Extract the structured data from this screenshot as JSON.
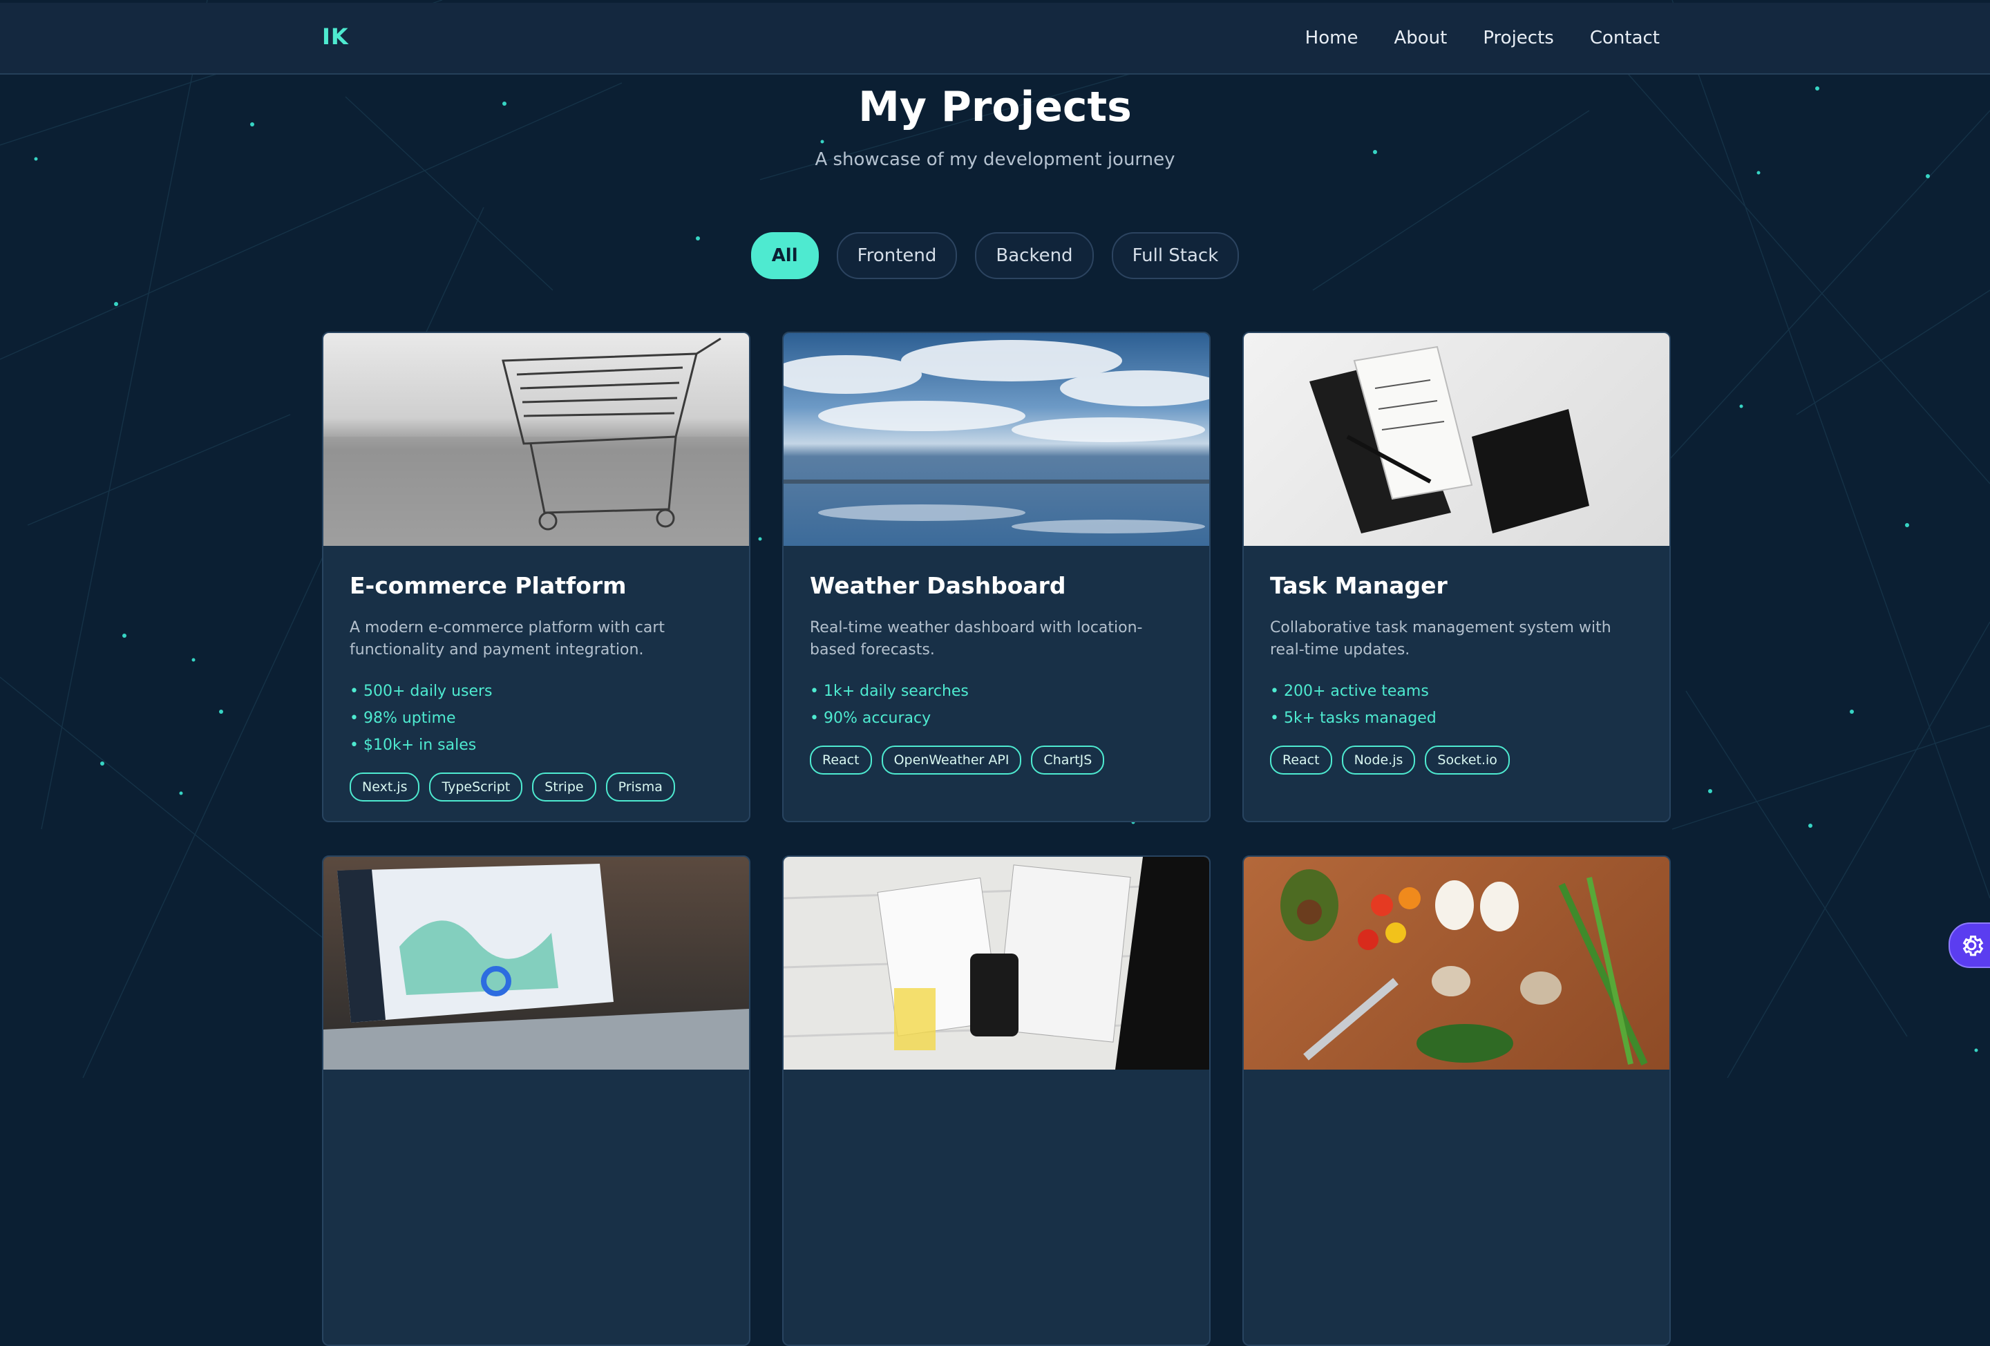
{
  "brand": {
    "logo": "IK"
  },
  "nav": {
    "items": [
      "Home",
      "About",
      "Projects",
      "Contact"
    ]
  },
  "hero": {
    "title": "My Projects",
    "subtitle": "A showcase of my development journey"
  },
  "filters": {
    "items": [
      "All",
      "Frontend",
      "Backend",
      "Full Stack"
    ],
    "active": "All"
  },
  "projects": [
    {
      "title": "E-commerce Platform",
      "description": "A modern e-commerce platform with cart functionality and payment integration.",
      "metrics": [
        "• 500+ daily users",
        "• 98% uptime",
        "• $10k+ in sales"
      ],
      "tags": [
        "Next.js",
        "TypeScript",
        "Stripe",
        "Prisma"
      ],
      "image": "shopping-cart-photo"
    },
    {
      "title": "Weather Dashboard",
      "description": "Real-time weather dashboard with location-based forecasts.",
      "metrics": [
        "• 1k+ daily searches",
        "• 90% accuracy"
      ],
      "tags": [
        "React",
        "OpenWeather API",
        "ChartJS"
      ],
      "image": "sky-and-lake-photo"
    },
    {
      "title": "Task Manager",
      "description": "Collaborative task management system with real-time updates.",
      "metrics": [
        "• 200+ active teams",
        "• 5k+ tasks managed"
      ],
      "tags": [
        "React",
        "Node.js",
        "Socket.io"
      ],
      "image": "notebook-and-pen-photo"
    },
    {
      "image": "laptop-analytics-photo"
    },
    {
      "image": "tax-documents-photo"
    },
    {
      "image": "vegetables-cutting-board-photo"
    }
  ],
  "colors": {
    "background": "#0b1f33",
    "accent": "#4eead0",
    "card": "#183047",
    "fab": "#5b3df0"
  },
  "icons": {
    "settings": "gear-icon"
  }
}
